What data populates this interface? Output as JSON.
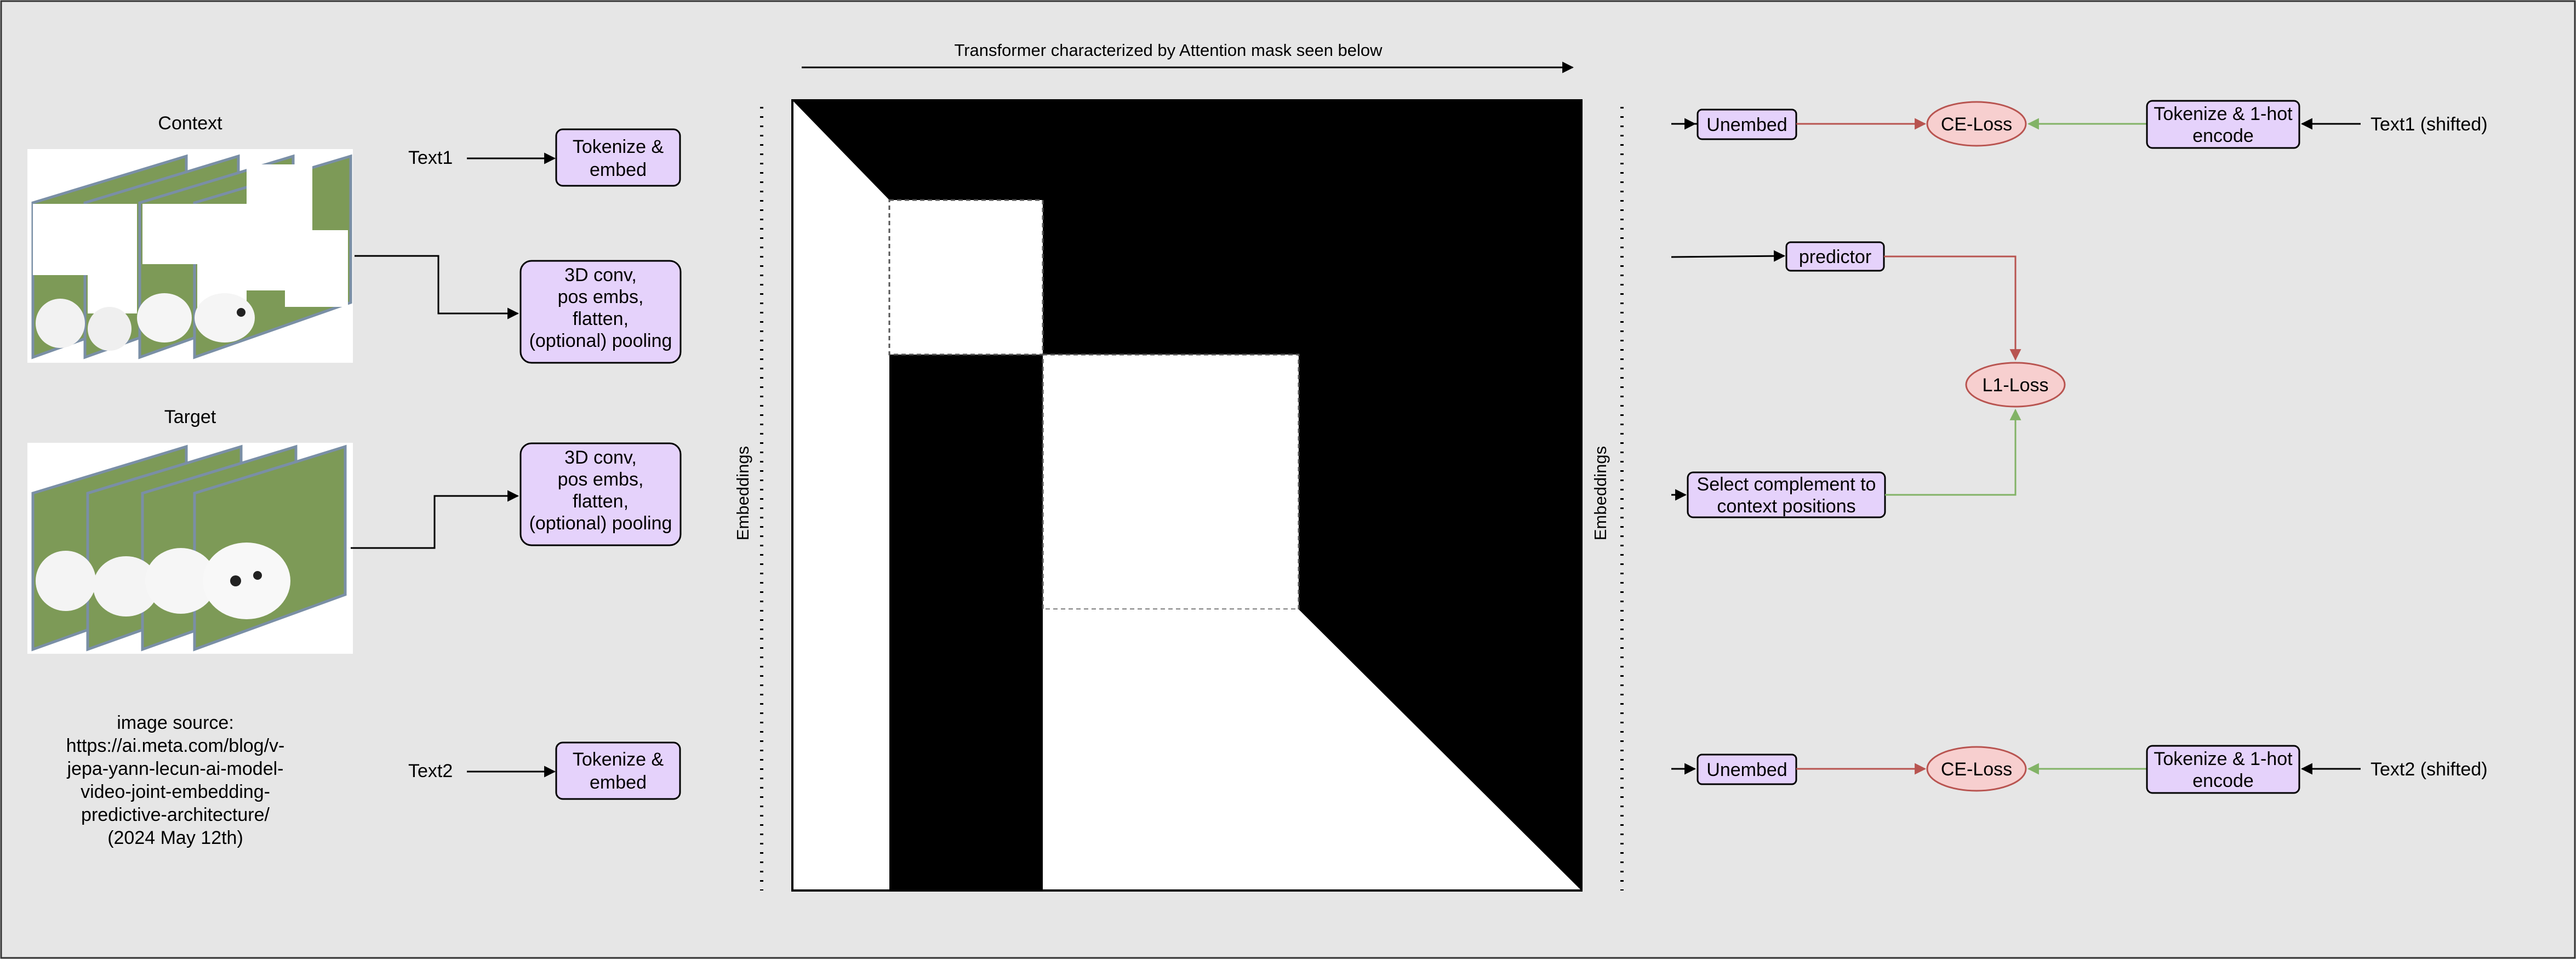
{
  "colors": {
    "background": "#e6e6e6",
    "box_fill": "#e5d2fb",
    "loss_fill": "#f7cfcf",
    "ce_arrow": "#b85450",
    "green_arrow": "#82b366"
  },
  "left": {
    "context_title": "Context",
    "target_title": "Target",
    "text1": "Text1",
    "text2": "Text2",
    "tokenize_embed_1": [
      "Tokenize &",
      "embed"
    ],
    "tokenize_embed_2": [
      "Tokenize &",
      "embed"
    ],
    "conv_context": [
      "3D conv,",
      "pos embs,",
      "flatten,",
      "(optional) pooling"
    ],
    "conv_target": [
      "3D conv,",
      "pos embs,",
      "flatten,",
      "(optional) pooling"
    ],
    "source_note": [
      "image source:",
      "https://ai.meta.com/blog/v-",
      "jepa-yann-lecun-ai-model-",
      "video-joint-embedding-",
      "predictive-architecture/",
      "(2024 May 12th)"
    ]
  },
  "center": {
    "top_caption": "Transformer characterized by Attention mask seen below",
    "embeddings_left": "Embeddings",
    "embeddings_right": "Embeddings"
  },
  "right": {
    "unembed_1": "Unembed",
    "unembed_2": "Unembed",
    "ce_loss_1": "CE-Loss",
    "ce_loss_2": "CE-Loss",
    "tokenize_onehot_1": [
      "Tokenize & 1-hot",
      "encode"
    ],
    "tokenize_onehot_2": [
      "Tokenize & 1-hot",
      "encode"
    ],
    "text1_shifted": "Text1 (shifted)",
    "text2_shifted": "Text2 (shifted)",
    "predictor": "predictor",
    "l1_loss": "L1-Loss",
    "select_complement": [
      "Select complement to",
      "context positions"
    ]
  }
}
